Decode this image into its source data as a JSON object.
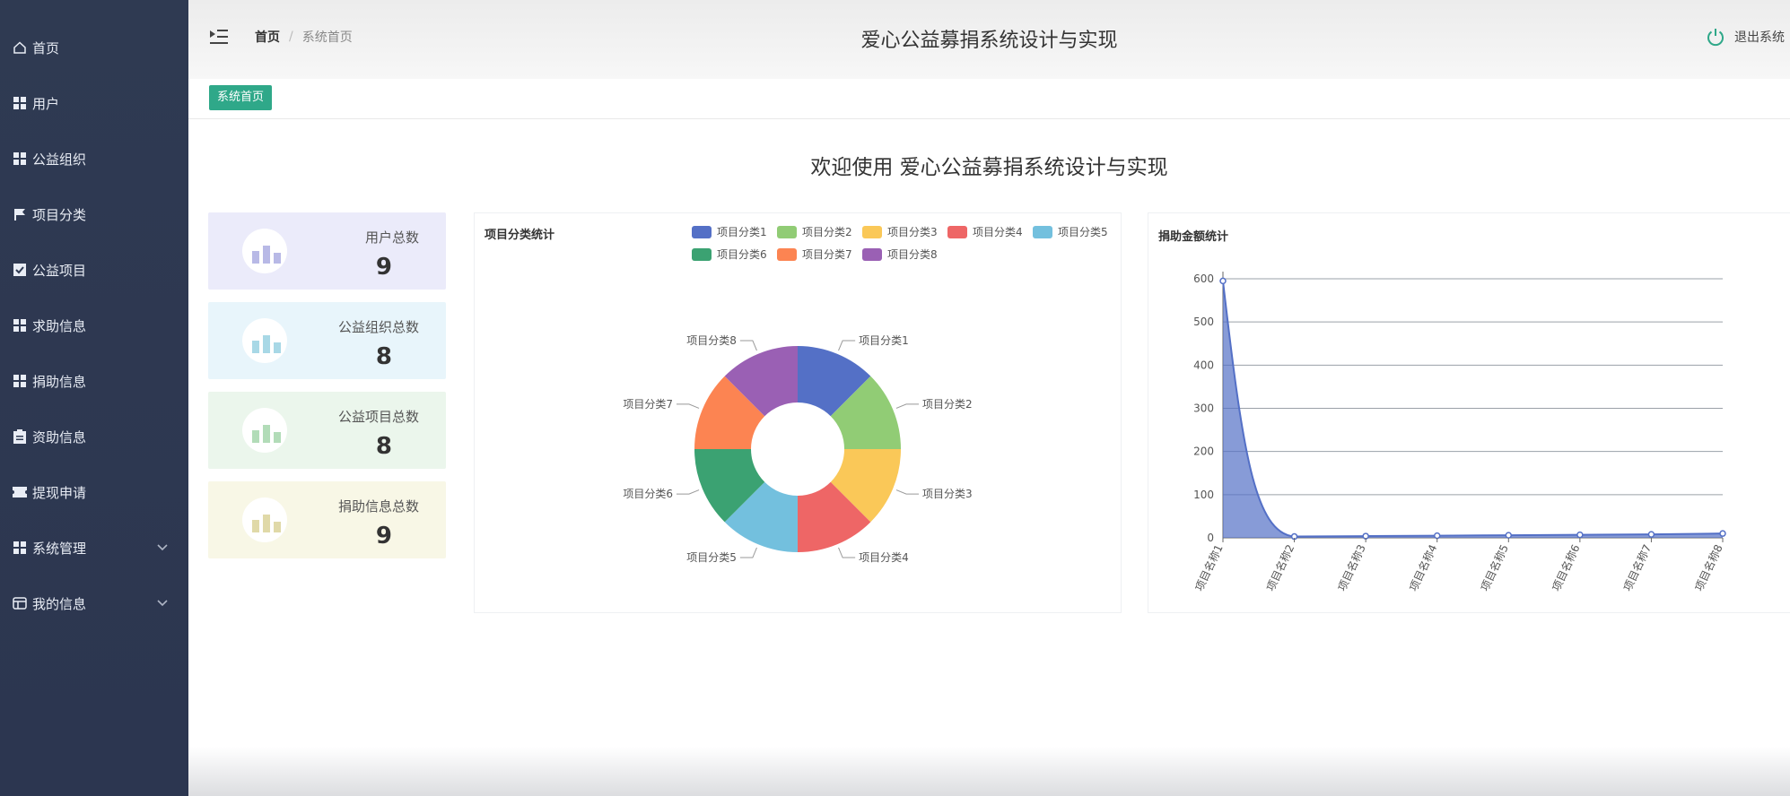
{
  "header": {
    "breadcrumb_home": "首页",
    "breadcrumb_sep": "/",
    "breadcrumb_current": "系统首页",
    "title": "爱心公益募捐系统设计与实现",
    "logout": "退出系统"
  },
  "sidebar": {
    "items": [
      {
        "label": "首页",
        "icon": "home-icon"
      },
      {
        "label": "用户",
        "icon": "grid-icon"
      },
      {
        "label": "公益组织",
        "icon": "grid-icon"
      },
      {
        "label": "项目分类",
        "icon": "flag-icon"
      },
      {
        "label": "公益项目",
        "icon": "checkbox-icon"
      },
      {
        "label": "求助信息",
        "icon": "grid-icon"
      },
      {
        "label": "捐助信息",
        "icon": "grid-icon"
      },
      {
        "label": "资助信息",
        "icon": "clipboard-icon"
      },
      {
        "label": "提现申请",
        "icon": "ticket-icon"
      },
      {
        "label": "系统管理",
        "icon": "grid-icon"
      },
      {
        "label": "我的信息",
        "icon": "card-icon"
      }
    ]
  },
  "tabs": {
    "active": "系统首页"
  },
  "welcome": "欢迎使用 爱心公益募捐系统设计与实现",
  "stats": [
    {
      "label": "用户总数",
      "value": "9",
      "bg": "#ebebfa",
      "color": "#b8b9e6"
    },
    {
      "label": "公益组织总数",
      "value": "8",
      "bg": "#e8f5fb",
      "color": "#a8d8e6"
    },
    {
      "label": "公益项目总数",
      "value": "8",
      "bg": "#ebf6ec",
      "color": "#b2dcb8"
    },
    {
      "label": "捐助信息总数",
      "value": "9",
      "bg": "#f8f7e6",
      "color": "#e0d9a8"
    }
  ],
  "pie_panel_title": "项目分类统计",
  "line_panel_title": "捐助金额统计",
  "chart_data": [
    {
      "type": "pie",
      "title": "项目分类统计",
      "categories": [
        "项目分类1",
        "项目分类2",
        "项目分类3",
        "项目分类4",
        "项目分类5",
        "项目分类6",
        "项目分类7",
        "项目分类8"
      ],
      "values": [
        1,
        1,
        1,
        1,
        1,
        1,
        1,
        1
      ],
      "colors": [
        "#5470c6",
        "#91cc75",
        "#fac858",
        "#ee6666",
        "#73c0de",
        "#3ba272",
        "#fc8452",
        "#9a60b4"
      ],
      "legend": "top-right",
      "donut": true
    },
    {
      "type": "area",
      "title": "捐助金额统计",
      "categories": [
        "项目名称1",
        "项目名称2",
        "项目名称3",
        "项目名称4",
        "项目名称5",
        "项目名称6",
        "项目名称7",
        "项目名称8"
      ],
      "values": [
        595,
        3,
        4,
        5,
        6,
        7,
        8,
        10
      ],
      "ylim": [
        0,
        600
      ],
      "yticks": [
        0,
        100,
        200,
        300,
        400,
        500,
        600
      ],
      "color": "#5470c6",
      "grid": true
    }
  ]
}
